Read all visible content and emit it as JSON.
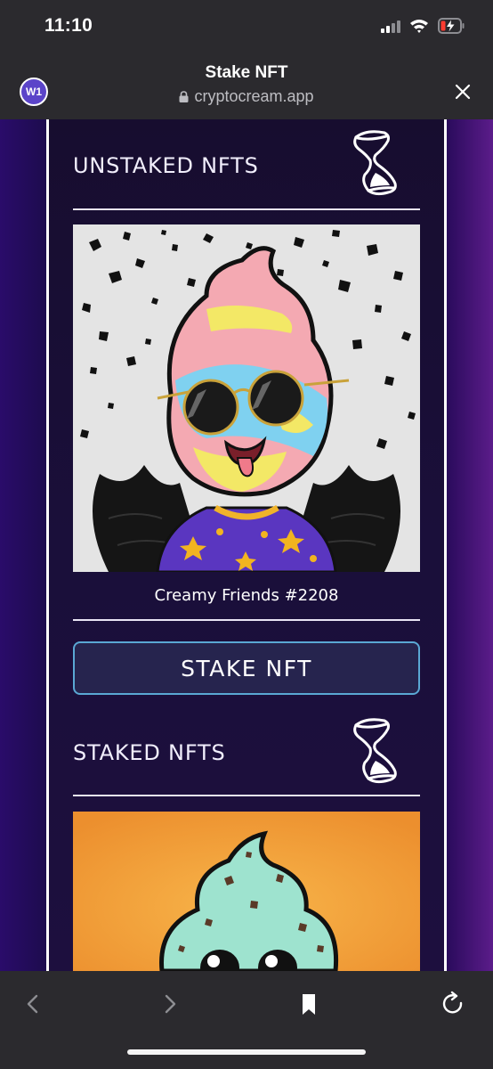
{
  "status_bar": {
    "time": "11:10"
  },
  "browser": {
    "tab_badge": "W1",
    "title": "Stake NFT",
    "url": "cryptocream.app",
    "icons": [
      "lock-icon",
      "close-icon"
    ]
  },
  "page": {
    "unstaked": {
      "heading": "UNSTAKED NFTS",
      "icon": "hourglass-icon",
      "nfts": [
        {
          "name": "Creamy Friends #2208"
        }
      ],
      "stake_button_label": "STAKE NFT"
    },
    "staked": {
      "heading": "STAKED NFTS",
      "icon": "hourglass-icon"
    }
  },
  "toolbar": {
    "icons": [
      "back-arrow-icon",
      "forward-arrow-icon",
      "bookmark-icon",
      "reload-icon"
    ]
  },
  "colors": {
    "background_left": "#2a0c6a",
    "background_right": "#5b1c8a",
    "panel": "#1a0f3a",
    "button_border": "#5aa8d4",
    "button_fill": "#26244e",
    "art_1_background": "#e4e4e4",
    "art_2_background": "#f4a63e",
    "browser_chrome": "#2b2a2e"
  }
}
